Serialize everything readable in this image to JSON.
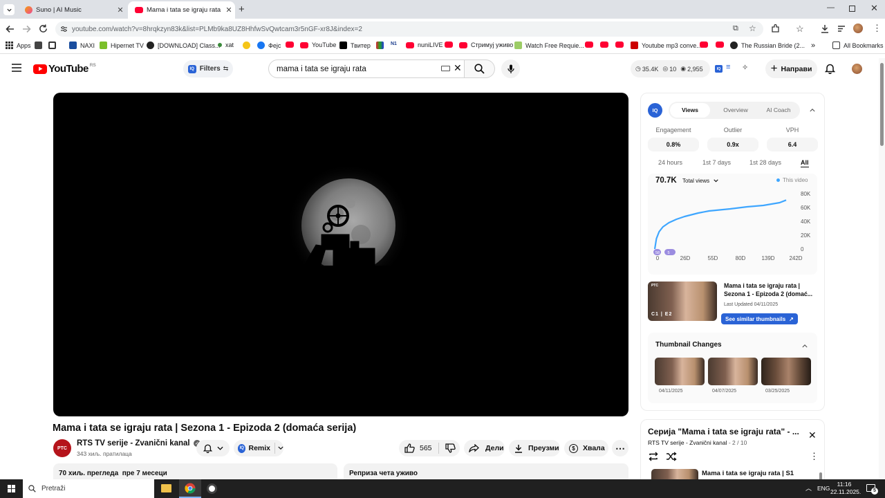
{
  "browser": {
    "tabs": [
      {
        "title": "Suno | AI Music"
      },
      {
        "title": "Mama i tata se igraju rata | Sez"
      }
    ],
    "url": "youtube.com/watch?v=8hrqkzyn83k&list=PLMb9ka8UZ8HhfwSvQwtcam3r5nGF-xr8J&index=2",
    "bookmarks": [
      "Apps",
      "NAXI",
      "Hipernet TV",
      "[DOWNLOAD] Class...",
      "xat",
      "Фејс",
      "YouTube",
      "Твитер",
      "nuniLIVE",
      "Стримуј уживо",
      "Watch Free Requie...",
      "Youtube mp3 conve...",
      "The Russian Bride (2..."
    ],
    "all_bookmarks": "All Bookmarks"
  },
  "youtube": {
    "logo_text": "YouTube",
    "region": "RS",
    "filters_label": "Filters",
    "search_value": "mama i tata se igraju rata",
    "header_stats": {
      "views": "35.4K",
      "count": "10",
      "watching": "2,955"
    },
    "create_label": "Направи"
  },
  "video": {
    "title": "Mama i tata se igraju rata | Sezona 1 - Epizoda 2 (domaća serija)",
    "channel_logo": "РТС",
    "channel_name": "RTS TV serije - Zvanični kanal",
    "subscribers": "343 хиљ. пратилаца",
    "remix_label": "Remix",
    "likes": "565",
    "share_label": "Дели",
    "download_label": "Преузми",
    "thanks_label": "Хвала",
    "description_views": "70 хиљ. прегледа  пре 7 месеци",
    "chat_replay": "Реприза чета уживо"
  },
  "vidiq": {
    "tabs": [
      "Views",
      "Overview",
      "AI Coach"
    ],
    "metrics": [
      {
        "label": "Engagement",
        "value": "0.8%"
      },
      {
        "label": "Outlier",
        "value": "0.9x"
      },
      {
        "label": "VPH",
        "value": "6.4"
      }
    ],
    "ranges": [
      "24 hours",
      "1st 7 days",
      "1st 28 days",
      "All"
    ],
    "total": "70.7K",
    "dropdown": "Total views",
    "legend": "This video",
    "thumb_title": "Mama i tata se igraju rata | Sezona 1 - Epizoda 2 (domać...",
    "last_updated": "Last Updated 04/11/2025",
    "similar_button": "See similar thumbnails",
    "thumbnail_changes_title": "Thumbnail Changes",
    "thumbnail_dates": [
      "04/11/2025",
      "04/07/2025",
      "03/25/2025"
    ],
    "thumb_caption": "C1 | E2"
  },
  "chart_data": {
    "type": "line",
    "x_tick_labels": [
      "0",
      "26D",
      "55D",
      "80D",
      "139D",
      "242D"
    ],
    "y_tick_labels": [
      "80K",
      "60K",
      "40K",
      "20K",
      "0"
    ],
    "ylim": [
      0,
      80000
    ],
    "xlim": [
      0,
      242
    ],
    "series": [
      {
        "name": "This video",
        "color": "#3ea6ff",
        "x": [
          0,
          3,
          8,
          15,
          26,
          40,
          55,
          70,
          80,
          100,
          139,
          170,
          200,
          230,
          242
        ],
        "y": [
          0,
          15000,
          25000,
          32000,
          38000,
          43000,
          47000,
          50000,
          52000,
          55000,
          58000,
          61000,
          63000,
          67000,
          70700
        ]
      }
    ],
    "markers": [
      "58",
      "5"
    ]
  },
  "playlist": {
    "title": "Серија \"Mama i tata se igraju rata\" - ...",
    "channel": "RTS TV serije - Zvanični kanal",
    "position": "2 / 10",
    "first_item": "Mama i tata se igraju rata | S1"
  },
  "taskbar": {
    "search_placeholder": "Pretraži",
    "lang": "ENG",
    "time": "11:16",
    "date": "22.11.2025.",
    "notif_count": "5"
  }
}
